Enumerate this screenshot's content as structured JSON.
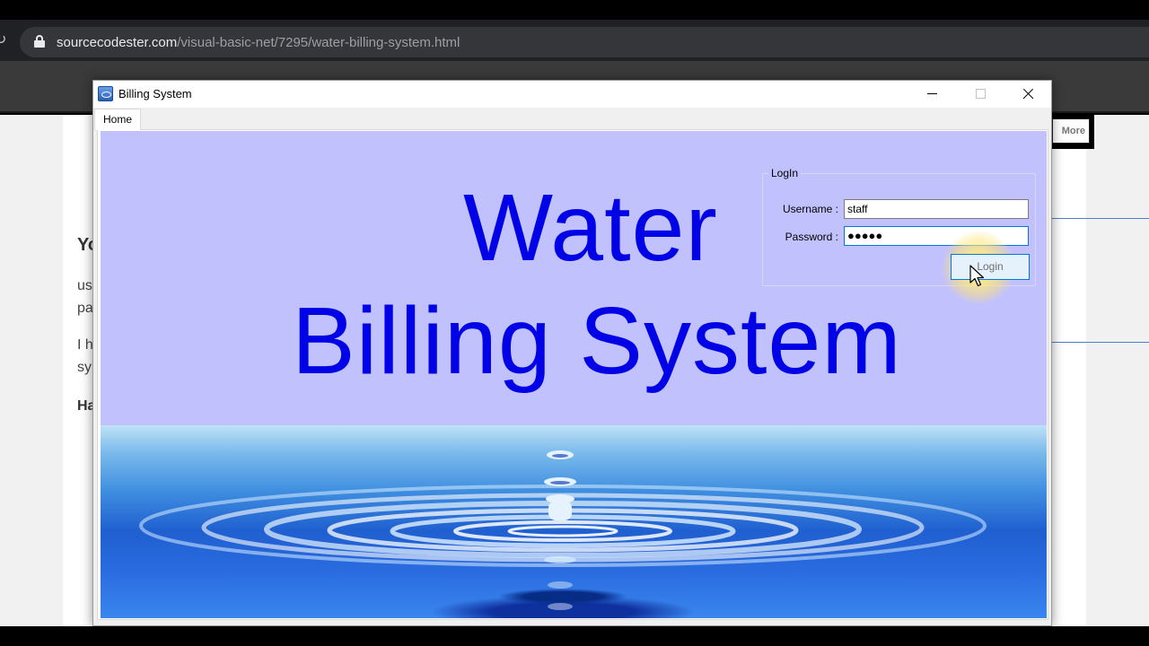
{
  "browser": {
    "url_domain": "sourcecodester.com",
    "url_path": "/visual-basic-net/7295/water-billing-system.html"
  },
  "background_page": {
    "fragments": [
      "Yo",
      "us",
      "pa",
      "I h",
      "sy",
      "Ha"
    ],
    "more_button": "More"
  },
  "window": {
    "title": "Billing System",
    "controls": [
      "minimize",
      "maximize",
      "close"
    ]
  },
  "tabs": {
    "home": "Home"
  },
  "banner": {
    "line1": "Water",
    "line2": "Billing System",
    "text_color": "#0202e6",
    "background_color": "#c1c1fe"
  },
  "login": {
    "group_title": "LogIn",
    "username_label": "Username :",
    "username_value": "staff",
    "password_label": "Password :",
    "password_value": "●●●●●",
    "button_label": "Login"
  },
  "icons": {
    "lock": "lock-icon",
    "app": "app-icon",
    "cursor": "mouse-cursor-icon"
  }
}
